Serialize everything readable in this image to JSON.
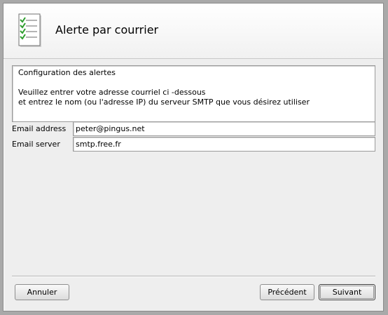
{
  "header": {
    "title": "Alerte par courrier",
    "icon": "checklist-icon"
  },
  "description": {
    "lines": [
      "Configuration des alertes",
      "",
      "Veuillez entrer votre adresse courriel ci -dessous",
      "et entrez le nom (ou l'adresse IP) du serveur SMTP que vous désirez utiliser"
    ]
  },
  "form": {
    "email_address": {
      "label": "Email address",
      "value": "peter@pingus.net"
    },
    "email_server": {
      "label": "Email server",
      "value": "smtp.free.fr"
    }
  },
  "buttons": {
    "cancel": "Annuler",
    "previous": "Précédent",
    "next": "Suivant"
  },
  "colors": {
    "check": "#2f9e2f",
    "background": "#eeeeee"
  }
}
